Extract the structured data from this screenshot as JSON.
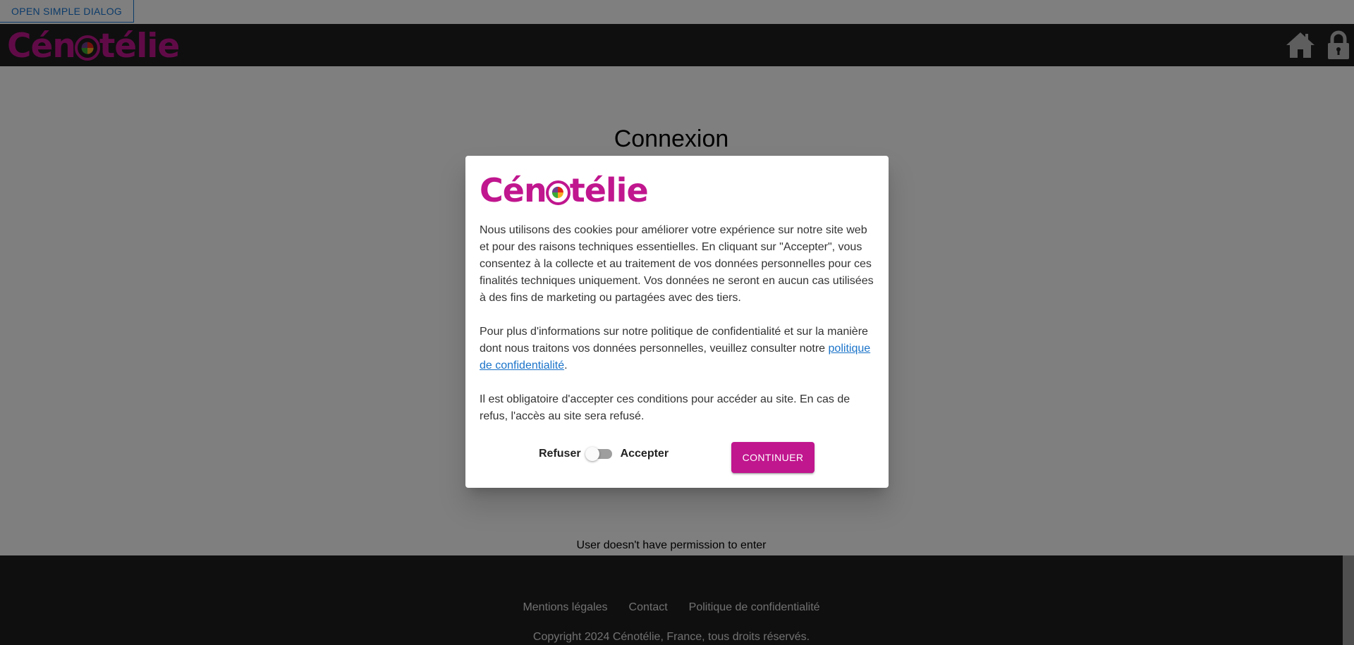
{
  "topbar": {
    "open_dialog_label": "OPEN SIMPLE DIALOG"
  },
  "brand": {
    "name_start": "Cén",
    "name_end": "télie",
    "color": "#c0168e"
  },
  "header": {
    "icons": [
      "home-icon",
      "lock-icon"
    ]
  },
  "main": {
    "title": "Connexion",
    "status": "User doesn't have permission to enter"
  },
  "dialog": {
    "paragraph1": "Nous utilisons des cookies pour améliorer votre expérience sur notre site web et pour des raisons techniques essentielles. En cliquant sur \"Accepter\", vous consentez à la collecte et au traitement de vos données personnelles pour ces finalités techniques uniquement. Vos données ne seront en aucun cas utilisées à des fins de marketing ou partagées avec des tiers.",
    "paragraph2_before": "Pour plus d'informations sur notre politique de confidentialité et sur la manière dont nous traitons vos données personnelles, veuillez consulter notre ",
    "privacy_link": "politique de confidentialité",
    "paragraph2_after": ".",
    "paragraph3": "Il est obligatoire d'accepter ces conditions pour accéder au site. En cas de refus, l'accès au site sera refusé.",
    "refuse_label": "Refuser",
    "accept_label": "Accepter",
    "consent_switch_on": false,
    "continue_label": "CONTINUER"
  },
  "footer": {
    "links": [
      "Mentions légales",
      "Contact",
      "Politique de confidentialité"
    ],
    "copyright": "Copyright 2024 Cénotélie, France, tous droits réservés."
  },
  "colors": {
    "header_bg": "#1f1f1f",
    "accent": "#c0168e",
    "link": "#1a73c9",
    "outline_button": "#1976d2"
  }
}
